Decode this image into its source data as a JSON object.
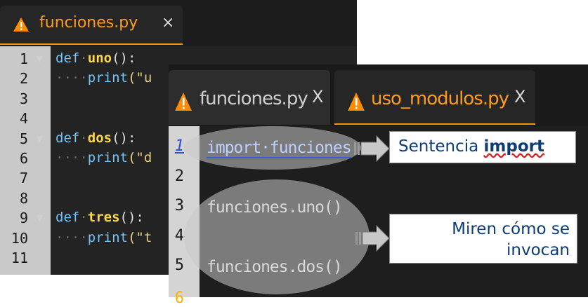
{
  "back_editor": {
    "tab": {
      "title": "funciones.py",
      "close": "×",
      "icon": "warning-triangle-icon"
    },
    "lines": [
      {
        "num": "1",
        "fold": "▼",
        "kw": "def",
        "sep": "·",
        "name": "uno",
        "rest": "():"
      },
      {
        "num": "2",
        "indent": "····",
        "call": "print",
        "args": "(\"u"
      },
      {
        "num": "3"
      },
      {
        "num": "4"
      },
      {
        "num": "5",
        "fold": "▼",
        "kw": "def",
        "sep": "·",
        "name": "dos",
        "rest": "():"
      },
      {
        "num": "6",
        "indent": "····",
        "call": "print",
        "args": "(\"d"
      },
      {
        "num": "7"
      },
      {
        "num": "8"
      },
      {
        "num": "9",
        "fold": "▼",
        "kw": "def",
        "sep": "·",
        "name": "tres",
        "rest": "():"
      },
      {
        "num": "10",
        "indent": "····",
        "call": "print",
        "args": "(\"t"
      },
      {
        "num": "11"
      }
    ]
  },
  "front_editor": {
    "tabs": [
      {
        "title": "funciones.py",
        "close": "X",
        "icon": "warning-triangle-icon"
      },
      {
        "title": "uso_modulos.py",
        "close": "X",
        "icon": "warning-triangle-icon"
      }
    ],
    "lines": [
      {
        "num": "1",
        "text": "import·funciones"
      },
      {
        "num": "2",
        "text": ""
      },
      {
        "num": "3",
        "text": "funciones.uno()"
      },
      {
        "num": "4",
        "text": ""
      },
      {
        "num": "5",
        "text": "funciones.dos()"
      },
      {
        "num": "6",
        "text": ""
      }
    ]
  },
  "callouts": {
    "import_prefix": "Sentencia ",
    "import_bold": "import",
    "invoke_line1": "Miren cómo se",
    "invoke_line2": "invocan"
  },
  "colors": {
    "accent_orange": "#ff9500",
    "keyword": "#6cc7ff",
    "function_name": "#ffd84a",
    "callout_text": "#0d3b73"
  }
}
